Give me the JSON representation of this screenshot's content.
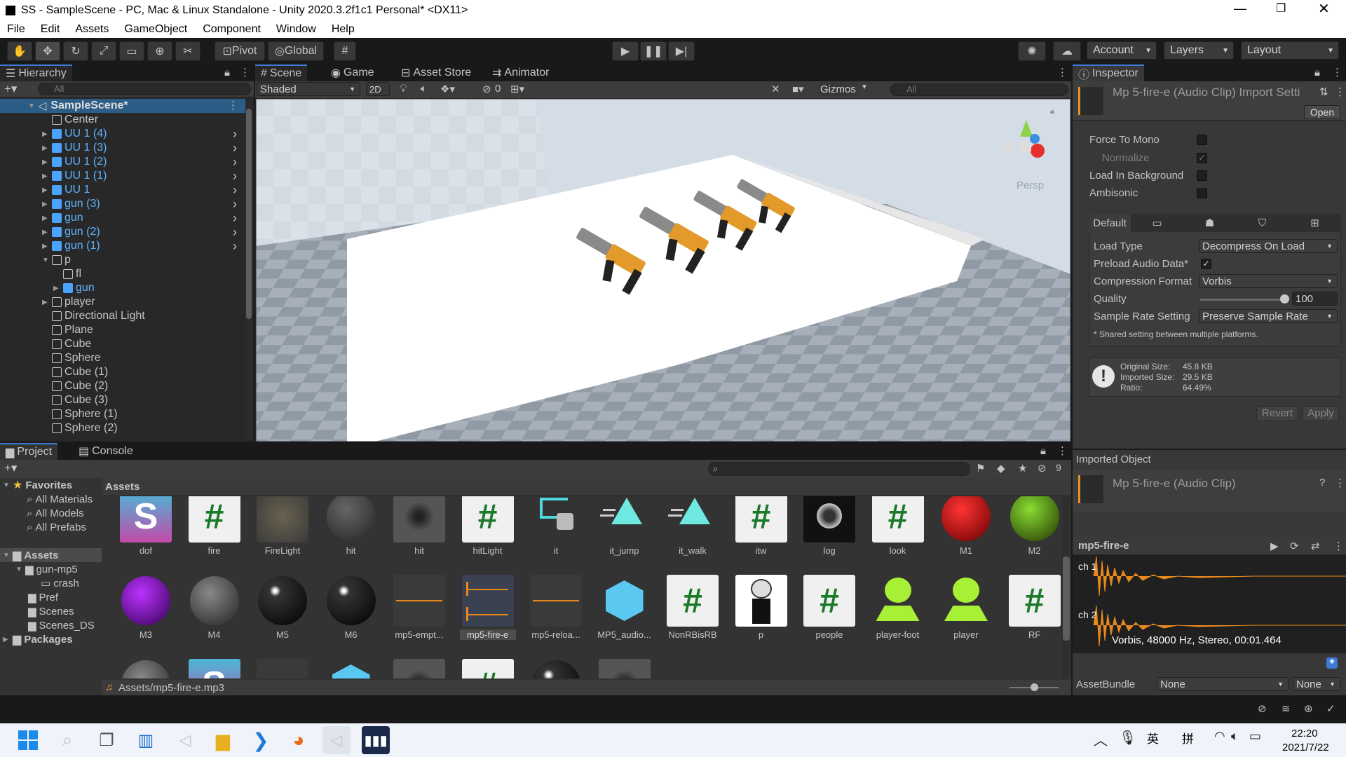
{
  "window": {
    "title": "SS - SampleScene - PC, Mac & Linux Standalone - Unity 2020.3.2f1c1 Personal* <DX11>"
  },
  "menu": [
    "File",
    "Edit",
    "Assets",
    "GameObject",
    "Component",
    "Window",
    "Help"
  ],
  "toolbar": {
    "pivot": "Pivot",
    "global": "Global",
    "account": "Account",
    "layers": "Layers",
    "layout": "Layout"
  },
  "hierarchy": {
    "tab": "Hierarchy",
    "search": "All",
    "scene": "SampleScene*",
    "items": [
      {
        "label": "Center",
        "color": "grey",
        "indent": 0,
        "arrow": false
      },
      {
        "label": "UU 1 (4)",
        "color": "blue",
        "indent": 0,
        "arrow": true
      },
      {
        "label": "UU 1 (3)",
        "color": "blue",
        "indent": 0,
        "arrow": true
      },
      {
        "label": "UU 1 (2)",
        "color": "blue",
        "indent": 0,
        "arrow": true
      },
      {
        "label": "UU 1 (1)",
        "color": "blue",
        "indent": 0,
        "arrow": true
      },
      {
        "label": "UU 1",
        "color": "blue",
        "indent": 0,
        "arrow": true
      },
      {
        "label": "gun (3)",
        "color": "blue",
        "indent": 0,
        "arrow": true
      },
      {
        "label": "gun",
        "color": "blue",
        "indent": 0,
        "arrow": true
      },
      {
        "label": "gun (2)",
        "color": "blue",
        "indent": 0,
        "arrow": true
      },
      {
        "label": "gun (1)",
        "color": "blue",
        "indent": 0,
        "arrow": true
      },
      {
        "label": "p",
        "color": "grey",
        "indent": 0,
        "arrow": "open"
      },
      {
        "label": "fl",
        "color": "grey",
        "indent": 1,
        "arrow": false
      },
      {
        "label": "gun",
        "color": "blue",
        "indent": 1,
        "arrow": true
      },
      {
        "label": "player",
        "color": "grey",
        "indent": 0,
        "arrow": true
      },
      {
        "label": "Directional Light",
        "color": "grey",
        "indent": 0,
        "arrow": false
      },
      {
        "label": "Plane",
        "color": "grey",
        "indent": 0,
        "arrow": false
      },
      {
        "label": "Cube",
        "color": "grey",
        "indent": 0,
        "arrow": false
      },
      {
        "label": "Sphere",
        "color": "grey",
        "indent": 0,
        "arrow": false
      },
      {
        "label": "Cube (1)",
        "color": "grey",
        "indent": 0,
        "arrow": false
      },
      {
        "label": "Cube (2)",
        "color": "grey",
        "indent": 0,
        "arrow": false
      },
      {
        "label": "Cube (3)",
        "color": "grey",
        "indent": 0,
        "arrow": false
      },
      {
        "label": "Sphere (1)",
        "color": "grey",
        "indent": 0,
        "arrow": false
      },
      {
        "label": "Sphere (2)",
        "color": "grey",
        "indent": 0,
        "arrow": false
      }
    ]
  },
  "sceneTabs": {
    "scene": "Scene",
    "game": "Game",
    "store": "Asset Store",
    "animator": "Animator"
  },
  "sceneBar": {
    "shading": "Shaded",
    "mode2d": "2D",
    "hidden": "0",
    "gizmos": "Gizmos",
    "search": "All",
    "persp": "Persp"
  },
  "inspector": {
    "tab": "Inspector",
    "title": "Mp 5-fire-e (Audio Clip) Import Setti",
    "open": "Open",
    "forceMono": "Force To Mono",
    "normalize": "Normalize",
    "loadBg": "Load In Background",
    "ambisonic": "Ambisonic",
    "platformDefault": "Default",
    "loadType": "Load Type",
    "loadTypeVal": "Decompress On Load",
    "preload": "Preload Audio Data*",
    "compression": "Compression Format",
    "compressionVal": "Vorbis",
    "quality": "Quality",
    "qualityVal": "100",
    "sampleRate": "Sample Rate Setting",
    "sampleRateVal": "Preserve Sample Rate",
    "shared": "* Shared setting between multiple platforms.",
    "origLabel": "Original Size:",
    "origVal": "45.8 KB",
    "impLabel": "Imported Size:",
    "impVal": "29.5 KB",
    "ratioLabel": "Ratio:",
    "ratioVal": "64.49%",
    "revert": "Revert",
    "apply": "Apply",
    "importedObject": "Imported Object",
    "clipName": "Mp 5-fire-e (Audio Clip)",
    "preview": "mp5-fire-e",
    "ch1": "ch 1",
    "ch2": "ch 2",
    "audioInfo": "Vorbis, 48000 Hz, Stereo, 00:01.464",
    "assetBundle": "AssetBundle",
    "bundleVal": "None",
    "variantVal": "None"
  },
  "project": {
    "tab": "Project",
    "console": "Console",
    "hiddenCount": "9",
    "favorites": "Favorites",
    "favItems": [
      "All Materials",
      "All Models",
      "All Prefabs"
    ],
    "assets": "Assets",
    "tree": [
      "gun-mp5",
      "crash",
      "Pref",
      "Scenes",
      "Scenes_DS"
    ],
    "packages": "Packages",
    "breadcrumb": "Assets",
    "row1": [
      "dof",
      "fire",
      "FireLight",
      "hit",
      "hit",
      "hitLight",
      "it",
      "it_jump",
      "it_walk",
      "itw",
      "log",
      "look",
      "M1",
      "M2"
    ],
    "row2": [
      "M3",
      "M4",
      "M5",
      "M6",
      "mp5-empt...",
      "mp5-fire-e",
      "mp5-reloa...",
      "MP5_audio...",
      "NonRBisRB",
      "p",
      "people",
      "player-foot",
      "player",
      "RF"
    ],
    "path": "Assets/mp5-fire-e.mp3"
  },
  "taskbar": {
    "time": "22:20",
    "date": "2021/7/22",
    "ime1": "英",
    "ime2": "拼"
  }
}
